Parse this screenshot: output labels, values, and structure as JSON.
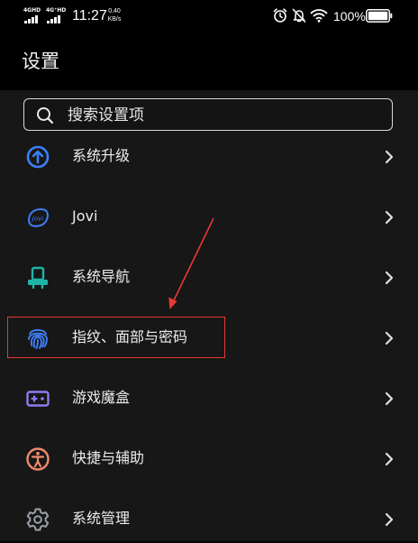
{
  "status_bar": {
    "sim1_label": "4GHD",
    "sim2_label": "4G⁺HD",
    "time": "11:27",
    "net_speed_value": "0.40",
    "net_speed_unit": "KB/s",
    "icons": [
      "alarm-icon",
      "mute-bell-icon",
      "wifi-icon",
      "battery-icon"
    ],
    "battery_percent": "100%"
  },
  "header": {
    "title": "设置"
  },
  "search": {
    "placeholder": "搜索设置项"
  },
  "settings": {
    "items": [
      {
        "label": "系统升级",
        "icon": "system-update-icon",
        "color": "#3d7ef5"
      },
      {
        "label": "Jovi",
        "icon": "jovi-icon",
        "color": "#3d7ef5"
      },
      {
        "label": "系统导航",
        "icon": "navigation-icon",
        "color": "#1fb5a8"
      },
      {
        "label": "指纹、面部与密码",
        "icon": "fingerprint-icon",
        "color": "#3d7ef5"
      },
      {
        "label": "游戏魔盒",
        "icon": "game-box-icon",
        "color": "#8c7cf0"
      },
      {
        "label": "快捷与辅助",
        "icon": "accessibility-icon",
        "color": "#f08a6e"
      },
      {
        "label": "系统管理",
        "icon": "gear-icon",
        "color": "#9aa0aa"
      }
    ]
  },
  "annotation": {
    "highlight_color": "#e53935"
  },
  "colors": {
    "background": "#000000",
    "list_background": "#171717",
    "text": "#ececec"
  }
}
